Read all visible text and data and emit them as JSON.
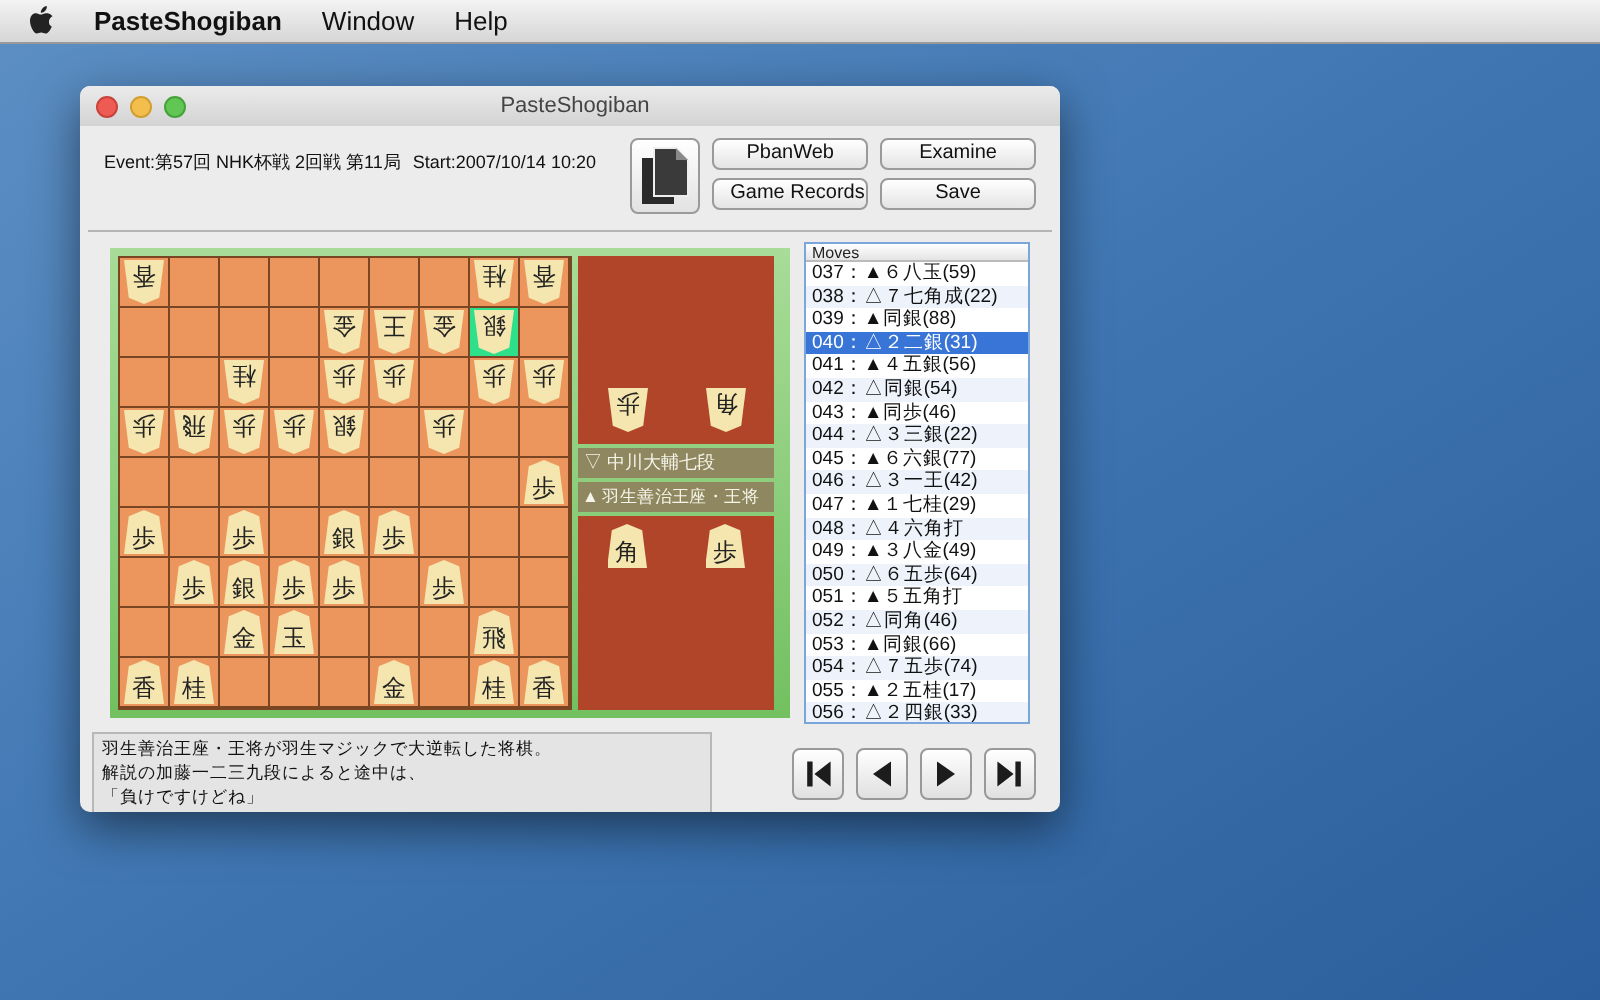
{
  "menu_bar": {
    "items": [
      {
        "label": "PasteShogiban",
        "bold": true
      },
      {
        "label": "Window",
        "bold": false
      },
      {
        "label": "Help",
        "bold": false
      }
    ]
  },
  "window": {
    "title": "PasteShogiban"
  },
  "header": {
    "event": "Event:第57回 NHK杯戦 2回戦 第11局",
    "start": "Start:2007/10/14 10:20",
    "buttons": [
      "PbanWeb",
      "Examine",
      "Game Records",
      "Save"
    ]
  },
  "board": {
    "rows": [
      {
        "squares": [
          {
            "kind": "piece",
            "piece": "香",
            "inverted": true
          },
          {
            "kind": "empty"
          },
          {
            "kind": "empty"
          },
          {
            "kind": "empty"
          },
          {
            "kind": "empty"
          },
          {
            "kind": "empty"
          },
          {
            "kind": "empty"
          },
          {
            "kind": "piece",
            "piece": "桂",
            "inverted": true
          },
          {
            "kind": "piece",
            "piece": "香",
            "inverted": true
          }
        ]
      },
      {
        "squares": [
          {
            "kind": "empty"
          },
          {
            "kind": "empty"
          },
          {
            "kind": "empty"
          },
          {
            "kind": "empty"
          },
          {
            "kind": "piece",
            "piece": "金",
            "inverted": true
          },
          {
            "kind": "piece",
            "piece": "王",
            "inverted": true
          },
          {
            "kind": "piece",
            "piece": "金",
            "inverted": true
          },
          {
            "kind": "piece",
            "piece": "銀",
            "inverted": true,
            "selected": true
          },
          {
            "kind": "empty"
          }
        ]
      },
      {
        "squares": [
          {
            "kind": "empty"
          },
          {
            "kind": "empty"
          },
          {
            "kind": "piece",
            "piece": "桂",
            "inverted": true
          },
          {
            "kind": "empty"
          },
          {
            "kind": "piece",
            "piece": "歩",
            "inverted": true
          },
          {
            "kind": "piece",
            "piece": "歩",
            "inverted": true
          },
          {
            "kind": "empty"
          },
          {
            "kind": "piece",
            "piece": "歩",
            "inverted": true
          },
          {
            "kind": "piece",
            "piece": "歩",
            "inverted": true
          }
        ]
      },
      {
        "squares": [
          {
            "kind": "piece",
            "piece": "歩",
            "inverted": true
          },
          {
            "kind": "piece",
            "piece": "飛",
            "inverted": true
          },
          {
            "kind": "piece",
            "piece": "歩",
            "inverted": true
          },
          {
            "kind": "piece",
            "piece": "歩",
            "inverted": true
          },
          {
            "kind": "piece",
            "piece": "銀",
            "inverted": true
          },
          {
            "kind": "empty"
          },
          {
            "kind": "piece",
            "piece": "歩",
            "inverted": true
          },
          {
            "kind": "empty"
          },
          {
            "kind": "empty"
          }
        ]
      },
      {
        "squares": [
          {
            "kind": "empty"
          },
          {
            "kind": "empty"
          },
          {
            "kind": "empty"
          },
          {
            "kind": "empty"
          },
          {
            "kind": "empty"
          },
          {
            "kind": "empty"
          },
          {
            "kind": "empty"
          },
          {
            "kind": "empty"
          },
          {
            "kind": "piece",
            "piece": "歩",
            "inverted": false
          }
        ]
      },
      {
        "squares": [
          {
            "kind": "piece",
            "piece": "歩",
            "inverted": false
          },
          {
            "kind": "empty"
          },
          {
            "kind": "piece",
            "piece": "歩",
            "inverted": false
          },
          {
            "kind": "empty"
          },
          {
            "kind": "piece",
            "piece": "銀",
            "inverted": false
          },
          {
            "kind": "piece",
            "piece": "歩",
            "inverted": false
          },
          {
            "kind": "empty"
          },
          {
            "kind": "empty"
          },
          {
            "kind": "empty"
          }
        ]
      },
      {
        "squares": [
          {
            "kind": "empty"
          },
          {
            "kind": "piece",
            "piece": "歩",
            "inverted": false
          },
          {
            "kind": "piece",
            "piece": "銀",
            "inverted": false
          },
          {
            "kind": "piece",
            "piece": "歩",
            "inverted": false
          },
          {
            "kind": "piece",
            "piece": "歩",
            "inverted": false
          },
          {
            "kind": "empty"
          },
          {
            "kind": "piece",
            "piece": "歩",
            "inverted": false
          },
          {
            "kind": "empty"
          },
          {
            "kind": "empty"
          }
        ]
      },
      {
        "squares": [
          {
            "kind": "empty"
          },
          {
            "kind": "empty"
          },
          {
            "kind": "piece",
            "piece": "金",
            "inverted": false
          },
          {
            "kind": "piece",
            "piece": "玉",
            "inverted": false
          },
          {
            "kind": "empty"
          },
          {
            "kind": "empty"
          },
          {
            "kind": "empty"
          },
          {
            "kind": "piece",
            "piece": "飛",
            "inverted": false
          },
          {
            "kind": "empty"
          }
        ]
      },
      {
        "squares": [
          {
            "kind": "piece",
            "piece": "香",
            "inverted": false
          },
          {
            "kind": "piece",
            "piece": "桂",
            "inverted": false
          },
          {
            "kind": "empty"
          },
          {
            "kind": "empty"
          },
          {
            "kind": "empty"
          },
          {
            "kind": "piece",
            "piece": "金",
            "inverted": false
          },
          {
            "kind": "empty"
          },
          {
            "kind": "piece",
            "piece": "桂",
            "inverted": false
          },
          {
            "kind": "piece",
            "piece": "香",
            "inverted": false
          }
        ]
      }
    ]
  },
  "gote": {
    "name": "▽ 中川大輔七段",
    "hand": [
      "歩",
      "角"
    ]
  },
  "sente": {
    "name": "▲ 羽生善治王座・王将",
    "hand": [
      "角",
      "歩"
    ]
  },
  "moves": {
    "header": "Moves",
    "items": [
      {
        "text": "037：▲６八玉(59)",
        "selected": false
      },
      {
        "text": "038：△７七角成(22)",
        "selected": false
      },
      {
        "text": "039：▲同銀(88)",
        "selected": false
      },
      {
        "text": "040：△２二銀(31)",
        "selected": true
      },
      {
        "text": "041：▲４五銀(56)",
        "selected": false
      },
      {
        "text": "042：△同銀(54)",
        "selected": false
      },
      {
        "text": "043：▲同歩(46)",
        "selected": false
      },
      {
        "text": "044：△３三銀(22)",
        "selected": false
      },
      {
        "text": "045：▲６六銀(77)",
        "selected": false
      },
      {
        "text": "046：△３一王(42)",
        "selected": false
      },
      {
        "text": "047：▲１七桂(29)",
        "selected": false
      },
      {
        "text": "048：△４六角打",
        "selected": false
      },
      {
        "text": "049：▲３八金(49)",
        "selected": false
      },
      {
        "text": "050：△６五歩(64)",
        "selected": false
      },
      {
        "text": "051：▲５五角打",
        "selected": false
      },
      {
        "text": "052：△同角(46)",
        "selected": false
      },
      {
        "text": "053：▲同銀(66)",
        "selected": false
      },
      {
        "text": "054：△７五歩(74)",
        "selected": false
      },
      {
        "text": "055：▲２五桂(17)",
        "selected": false
      },
      {
        "text": "056：△２四銀(33)",
        "selected": false
      }
    ]
  },
  "comment": [
    "羽生善治王座・王将が羽生マジックで大逆転した将棋。",
    "解説の加藤一二三九段によると途中は、",
    "「負けですけどね」"
  ]
}
